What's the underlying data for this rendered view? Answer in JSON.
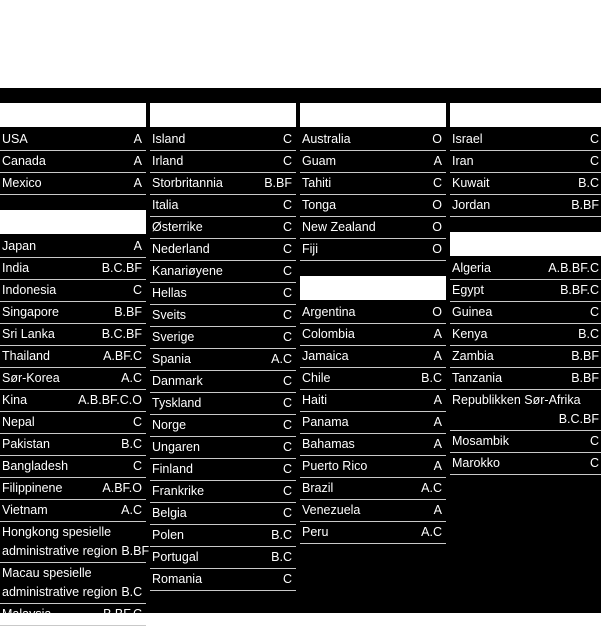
{
  "layout": {
    "background": "#000000",
    "page_background": "#ffffff",
    "text_color": "#ffffff",
    "rule_color": "#c9c9c9"
  },
  "columns": [
    {
      "name": "column-1",
      "blocks": [
        {
          "header": "",
          "rows": [
            {
              "name": "USA",
              "code": "A"
            },
            {
              "name": "Canada",
              "code": "A"
            },
            {
              "name": "Mexico",
              "code": "A"
            }
          ]
        },
        {
          "header": "",
          "rows": [
            {
              "name": "Japan",
              "code": "A"
            },
            {
              "name": "India",
              "code": "B.C.BF"
            },
            {
              "name": "Indonesia",
              "code": "C"
            },
            {
              "name": "Singapore",
              "code": "B.BF"
            },
            {
              "name": "Sri Lanka",
              "code": "B.C.BF"
            },
            {
              "name": "Thailand",
              "code": "A.BF.C"
            },
            {
              "name": "Sør-Korea",
              "code": "A.C"
            },
            {
              "name": "Kina",
              "code": "A.B.BF.C.O"
            },
            {
              "name": "Nepal",
              "code": "C"
            },
            {
              "name": "Pakistan",
              "code": "B.C"
            },
            {
              "name": "Bangladesh",
              "code": "C"
            },
            {
              "name": "Filippinene",
              "code": "A.BF.O"
            },
            {
              "name": "Vietnam",
              "code": "A.C"
            },
            {
              "name": "Hongkong spesielle administrative region",
              "name_line1": "Hongkong spesielle",
              "name_line2": "administrative region",
              "code": "B.BF",
              "wrapped": true
            },
            {
              "name": "Macau spesielle administrative region",
              "name_line1": "Macau spesielle",
              "name_line2": "administrative region",
              "code": "B.C",
              "wrapped": true
            },
            {
              "name": "Malaysia",
              "code": "B.BF.C"
            }
          ]
        }
      ]
    },
    {
      "name": "column-2",
      "blocks": [
        {
          "header": "",
          "rows": [
            {
              "name": "Island",
              "code": "C"
            },
            {
              "name": "Irland",
              "code": "C"
            },
            {
              "name": "Storbritannia",
              "code": "B.BF"
            },
            {
              "name": "Italia",
              "code": "C"
            },
            {
              "name": "Østerrike",
              "code": "C"
            },
            {
              "name": "Nederland",
              "code": "C"
            },
            {
              "name": "Kanariøyene",
              "code": "C"
            },
            {
              "name": "Hellas",
              "code": "C"
            },
            {
              "name": "Sveits",
              "code": "C"
            },
            {
              "name": "Sverige",
              "code": "C"
            },
            {
              "name": "Spania",
              "code": "A.C"
            },
            {
              "name": "Danmark",
              "code": "C"
            },
            {
              "name": "Tyskland",
              "code": "C"
            },
            {
              "name": "Norge",
              "code": "C"
            },
            {
              "name": "Ungaren",
              "code": "C"
            },
            {
              "name": "Finland",
              "code": "C"
            },
            {
              "name": "Frankrike",
              "code": "C"
            },
            {
              "name": "Belgia",
              "code": "C"
            },
            {
              "name": "Polen",
              "code": "B.C"
            },
            {
              "name": "Portugal",
              "code": "B.C"
            },
            {
              "name": "Romania",
              "code": "C"
            }
          ]
        }
      ]
    },
    {
      "name": "column-3",
      "blocks": [
        {
          "header": "",
          "rows": [
            {
              "name": "Australia",
              "code": "O"
            },
            {
              "name": "Guam",
              "code": "A"
            },
            {
              "name": "Tahiti",
              "code": "C"
            },
            {
              "name": "Tonga",
              "code": "O"
            },
            {
              "name": "New Zealand",
              "code": "O"
            },
            {
              "name": "Fiji",
              "code": "O"
            }
          ]
        },
        {
          "header": "",
          "rows": [
            {
              "name": "Argentina",
              "code": "O"
            },
            {
              "name": "Colombia",
              "code": "A"
            },
            {
              "name": "Jamaica",
              "code": "A"
            },
            {
              "name": "Chile",
              "code": "B.C"
            },
            {
              "name": "Haiti",
              "code": "A"
            },
            {
              "name": "Panama",
              "code": "A"
            },
            {
              "name": "Bahamas",
              "code": "A"
            },
            {
              "name": "Puerto Rico",
              "code": "A"
            },
            {
              "name": "Brazil",
              "code": "A.C"
            },
            {
              "name": "Venezuela",
              "code": "A"
            },
            {
              "name": "Peru",
              "code": "A.C"
            }
          ]
        }
      ]
    },
    {
      "name": "column-4",
      "blocks": [
        {
          "header": "",
          "rows": [
            {
              "name": "Israel",
              "code": "C"
            },
            {
              "name": "Iran",
              "code": "C"
            },
            {
              "name": "Kuwait",
              "code": "B.C"
            },
            {
              "name": "Jordan",
              "code": "B.BF"
            }
          ]
        },
        {
          "header": "",
          "rows": [
            {
              "name": "Algeria",
              "code": "A.B.BF.C"
            },
            {
              "name": "Egypt",
              "code": "B.BF.C"
            },
            {
              "name": "Guinea",
              "code": "C"
            },
            {
              "name": "Kenya",
              "code": "B.C"
            },
            {
              "name": "Zambia",
              "code": "B.BF"
            },
            {
              "name": "Tanzania",
              "code": "B.BF"
            },
            {
              "name": "Republikken Sør-Afrika",
              "name_line1": "Republikken Sør-Afrika",
              "name_line2": "",
              "code": "B.C.BF",
              "wrapped": true
            },
            {
              "name": "Mosambik",
              "code": "C"
            },
            {
              "name": "Marokko",
              "code": "C"
            }
          ]
        }
      ]
    }
  ]
}
